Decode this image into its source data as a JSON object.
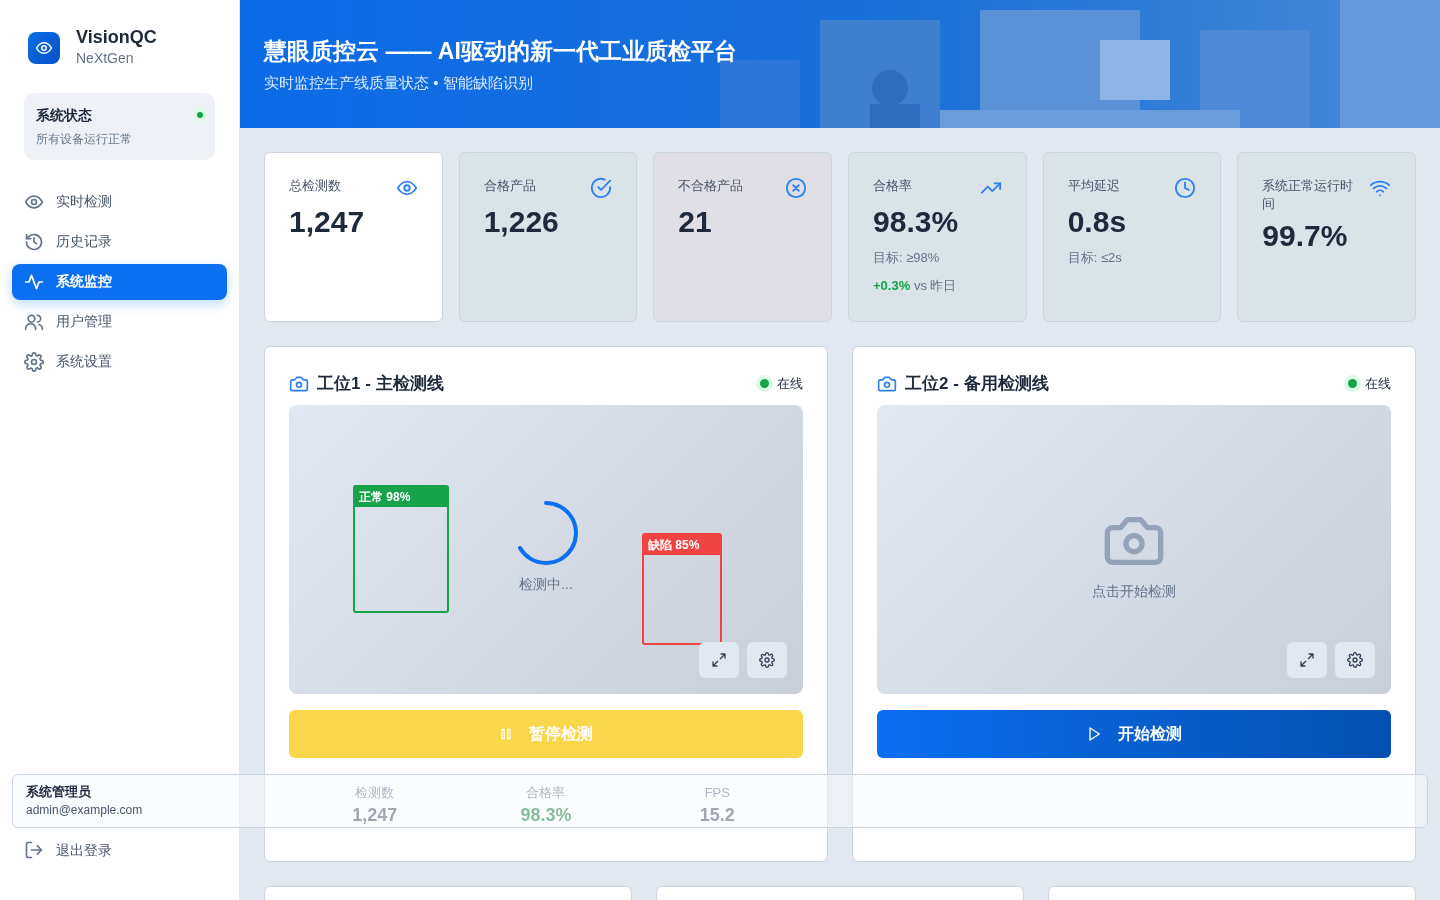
{
  "brand": {
    "name": "VisionQC",
    "subtitle": "NeXtGen"
  },
  "system_status": {
    "title": "系统状态",
    "message": "所有设备运行正常",
    "online": true
  },
  "nav": [
    {
      "label": "实时检测",
      "selected": false
    },
    {
      "label": "历史记录",
      "selected": false
    },
    {
      "label": "系统监控",
      "selected": true
    },
    {
      "label": "用户管理",
      "selected": false
    },
    {
      "label": "系统设置",
      "selected": false
    }
  ],
  "user": {
    "name": "系统管理员",
    "email": "admin@example.com"
  },
  "logout": "退出登录",
  "banner": {
    "title": "慧眼质控云 —— AI驱动的新一代工业质检平台",
    "subtitle": "实时监控生产线质量状态 • 智能缺陷识别"
  },
  "stats": [
    {
      "label": "总检测数",
      "value": "1,247",
      "color": "#ffffff"
    },
    {
      "label": "合格产品",
      "value": "1,226",
      "color": "#d9e3e8"
    },
    {
      "label": "不合格产品",
      "value": "21",
      "color": "#e0dfe6"
    },
    {
      "label": "合格率",
      "value": "98.3%",
      "color": "#d9e3e8",
      "target": "目标: ≥98%",
      "delta": "+0.3%",
      "compare": "vs 昨日"
    },
    {
      "label": "平均延迟",
      "value": "0.8s",
      "color": "#d9e3e8",
      "target": "目标: ≤2s"
    },
    {
      "label": "系统正常运行时间",
      "value": "99.7%",
      "color": "#d9e3e8"
    }
  ],
  "stations": [
    {
      "title": "工位1 - 主检测线",
      "status": "在线",
      "online": true,
      "running": true,
      "loading_text": "检测中...",
      "detections": [
        {
          "label": "正常 98%",
          "kind": "normal"
        },
        {
          "label": "缺陷 85%",
          "kind": "defect"
        }
      ],
      "action": "暂停检测",
      "stats": [
        {
          "label": "检测数",
          "value": "1,247",
          "kind": "count"
        },
        {
          "label": "合格率",
          "value": "98.3%",
          "kind": "rate"
        },
        {
          "label": "FPS",
          "value": "15.2",
          "kind": "count"
        }
      ]
    },
    {
      "title": "工位2 - 备用检测线",
      "status": "在线",
      "online": true,
      "running": false,
      "idle_text": "点击开始检测",
      "action": "开始检测"
    }
  ]
}
